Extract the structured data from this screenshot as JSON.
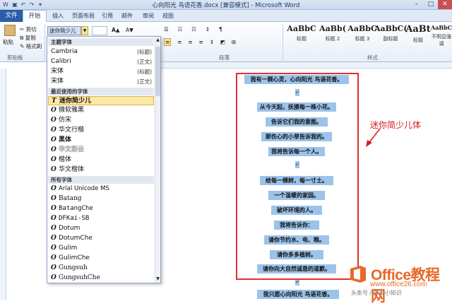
{
  "window": {
    "title": "心向阳光 鸟语花香.docx [兼容模式] - Microsoft Word"
  },
  "tabs": [
    {
      "label": "文件"
    },
    {
      "label": "开始"
    },
    {
      "label": "插入"
    },
    {
      "label": "页面布局"
    },
    {
      "label": "引用"
    },
    {
      "label": "邮件"
    },
    {
      "label": "审阅"
    },
    {
      "label": "视图"
    }
  ],
  "clipboard": {
    "paste": "粘贴",
    "cut": "剪切",
    "copy": "复制",
    "format_painter": "格式刷",
    "group_label": "剪贴板"
  },
  "font_toolbar": {
    "font_name": "迷你简少儿",
    "bold": "B",
    "italic": "I",
    "underline": "U"
  },
  "paragraph_group_label": "段落",
  "styles_group_label": "样式",
  "styles": [
    {
      "sample": "AaBbC",
      "name": "标题"
    },
    {
      "sample": "AaBb(",
      "name": "标题 2"
    },
    {
      "sample": "AaBbC",
      "name": "标题 3"
    },
    {
      "sample": "AaBbC(",
      "name": "副标题"
    },
    {
      "sample": "AaBt",
      "name": "标题"
    },
    {
      "sample": "AaBbCcI",
      "name": "不明显强调"
    }
  ],
  "font_dropdown": {
    "theme_header": "主题字体",
    "theme_fonts": [
      {
        "name": "Cambria",
        "tag": "(标题)"
      },
      {
        "name": "Calibri",
        "tag": "(正文)"
      },
      {
        "name": "宋体",
        "tag": "(标题)"
      },
      {
        "name": "宋体",
        "tag": "(正文)"
      }
    ],
    "recent_header": "最近使用的字体",
    "recent_fonts": [
      {
        "name": "迷你简少儿"
      },
      {
        "name": "微软雅黑"
      },
      {
        "name": "仿宋"
      },
      {
        "name": "华文行楷"
      },
      {
        "name": "黑体"
      },
      {
        "name": "华文彩云"
      },
      {
        "name": "楷体"
      },
      {
        "name": "华文楷体"
      }
    ],
    "all_header": "所有字体",
    "all_fonts": [
      {
        "name": "Arial Unicode MS"
      },
      {
        "name": "Batang"
      },
      {
        "name": "BatangChe"
      },
      {
        "name": "DFKai-SB"
      },
      {
        "name": "Dotum"
      },
      {
        "name": "DotumChe"
      },
      {
        "name": "Gulim"
      },
      {
        "name": "GulimChe"
      },
      {
        "name": "Gungsuh"
      },
      {
        "name": "GungsuhChe"
      }
    ]
  },
  "document": {
    "lines": [
      "我有一颗心灵，心向阳光 鸟语花香。",
      "从今天起，抚摸每一株小花。",
      "告诉它们我的意图。",
      "那伤心的小草告诉我的。",
      "我将告诉每一个人。",
      "给每一棵树，每一寸土。",
      "一个温暖的家园。",
      "破坏环境的人。",
      "我将告诉你：",
      "请你节约水、电、粮。",
      "请你多多植树。",
      "请你向大自然诚恳的道歉。",
      "我只愿心向阳光 鸟语花香。"
    ]
  },
  "annotation": "迷你简少儿体",
  "watermark": {
    "title": "Office教程网",
    "url": "www.office26.com",
    "credit": "头条号 / 办公小知识"
  },
  "colors": {
    "accent": "#2a5ea8",
    "highlight": "#9cc3ea",
    "annotation": "#d02020",
    "watermark": "#e8692a"
  }
}
